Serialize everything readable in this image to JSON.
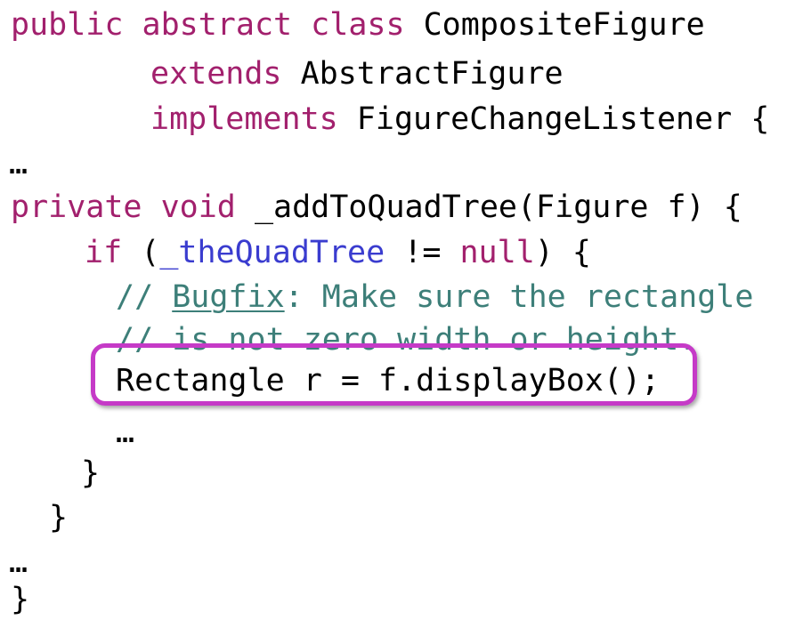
{
  "code": {
    "line1": {
      "kw1": "public",
      "kw2": "abstract",
      "kw3": "class",
      "name": "CompositeFigure"
    },
    "line2": {
      "kw": "extends",
      "name": "AbstractFigure"
    },
    "line3": {
      "kw": "implements",
      "name": "FigureChangeListener {"
    },
    "line4": {
      "ellipsis": "…"
    },
    "line5": {
      "kw1": "private",
      "kw2": "void",
      "rest": "_addToQuadTree(Figure f) {"
    },
    "line6": {
      "kw": "if",
      "open": "(",
      "field": "_theQuadTree",
      "op": " != ",
      "null": "null",
      "close": ") {"
    },
    "line7": {
      "slashes": "// ",
      "bugfix": "Bugfix",
      "text": ": Make sure the rectangle"
    },
    "line8": {
      "text": "// is not zero width or height."
    },
    "line9": {
      "text": "Rectangle r = f.displayBox();"
    },
    "line10": {
      "ellipsis": "…"
    },
    "line11": {
      "brace": "}"
    },
    "line12": {
      "brace": "}"
    },
    "line13": {
      "ellipsis": "…"
    },
    "line14": {
      "brace": "}"
    }
  },
  "colors": {
    "keyword": "#a2206d",
    "field": "#3a3ccf",
    "comment": "#3d7f79",
    "highlight": "#c53ac7"
  }
}
